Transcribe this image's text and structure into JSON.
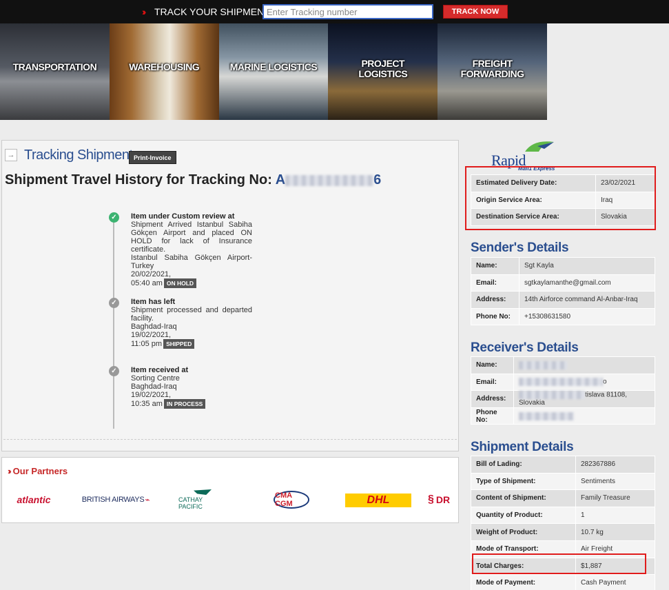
{
  "topbar": {
    "track_label": "TRACK YOUR SHIPMENT",
    "tracking_placeholder": "Enter Tracking number",
    "track_button": "TRACK NOW"
  },
  "banner": {
    "tiles": [
      {
        "label": "TRANSPORTATION"
      },
      {
        "label": "WAREHOUSING"
      },
      {
        "label": "MARINE LOGISTICS"
      },
      {
        "label": "PROJECT LOGISTICS"
      },
      {
        "label": "FREIGHT FORWARDING"
      }
    ]
  },
  "tracking": {
    "title": "Tracking Shipment",
    "print_button": "Print-Invoice",
    "history_prefix": "Shipment Travel History for Tracking No:",
    "tracking_no_visible": "A",
    "tracking_no_tail": "6",
    "events": [
      {
        "title": "Item under Custom review at",
        "description": "Shipment Arrived Istanbul Sabiha Gökçen Airport and placed ON HOLD for lack of Insurance certificate.",
        "location": "Istanbul Sabiha Gökçen Airport-Turkey",
        "date": "20/02/2021,",
        "time": "05:40 am",
        "status": "ON HOLD",
        "icon": "check-circle-icon"
      },
      {
        "title": "Item has left",
        "description": "Shipment processed and departed facility.",
        "location": "Baghdad-Iraq",
        "date": "19/02/2021,",
        "time": "11:05 pm",
        "status": "SHIPPED",
        "icon": "check-circle-icon"
      },
      {
        "title": "Item received at",
        "description": "Sorting Centre",
        "location": "Baghdad-Iraq",
        "date": "19/02/2021,",
        "time": "10:35 am",
        "status": "IN PROCESS",
        "icon": "check-circle-icon"
      }
    ]
  },
  "partners": {
    "heading": "Our Partners",
    "logos": [
      {
        "name": "atlantic"
      },
      {
        "name": "BRITISH AIRWAYS"
      },
      {
        "name": "CATHAY PACIFIC"
      },
      {
        "name": "CMA CGM"
      },
      {
        "name": "DHL"
      },
      {
        "name": "DR"
      }
    ]
  },
  "brand": {
    "name": "Rapid",
    "subtitle": "Mail1 Express"
  },
  "delivery": {
    "rows": [
      {
        "label": "Estimated Delivery Date:",
        "value": "23/02/2021"
      },
      {
        "label": "Origin Service Area:",
        "value": "Iraq"
      },
      {
        "label": "Destination Service Area:",
        "value": "Slovakia"
      }
    ]
  },
  "sender": {
    "heading": "Sender's Details",
    "rows": [
      {
        "label": "Name:",
        "value": "Sgt Kayla"
      },
      {
        "label": "Email:",
        "value": "sgtkaylamanthe@gmail.com"
      },
      {
        "label": "Address:",
        "value": "14th Airforce command Al-Anbar-Iraq"
      },
      {
        "label": "Phone No:",
        "value": "+15308631580"
      }
    ]
  },
  "receiver": {
    "heading": "Receiver's Details",
    "rows": [
      {
        "label": "Name:",
        "value": ""
      },
      {
        "label": "Email:",
        "value": "o"
      },
      {
        "label": "Address:",
        "value": "tislava 81108, Slovakia"
      },
      {
        "label": "Phone No:",
        "value": ""
      }
    ]
  },
  "shipment": {
    "heading": "Shipment Details",
    "rows": [
      {
        "label": "Bill of Lading:",
        "value": "282367886"
      },
      {
        "label": "Type of Shipment:",
        "value": "Sentiments"
      },
      {
        "label": "Content of Shipment:",
        "value": "Family Treasure"
      },
      {
        "label": "Quantity of Product:",
        "value": "1"
      },
      {
        "label": "Weight of Product:",
        "value": "10.7 kg"
      },
      {
        "label": "Mode of Transport:",
        "value": "Air Freight"
      },
      {
        "label": "Total Charges:",
        "value": "$1,887"
      },
      {
        "label": "Mode of Payment:",
        "value": "Cash Payment"
      }
    ]
  },
  "colors": {
    "accent": "#2a4e8f",
    "brand_red": "#d52b2b",
    "highlight": "#e01b1b"
  }
}
